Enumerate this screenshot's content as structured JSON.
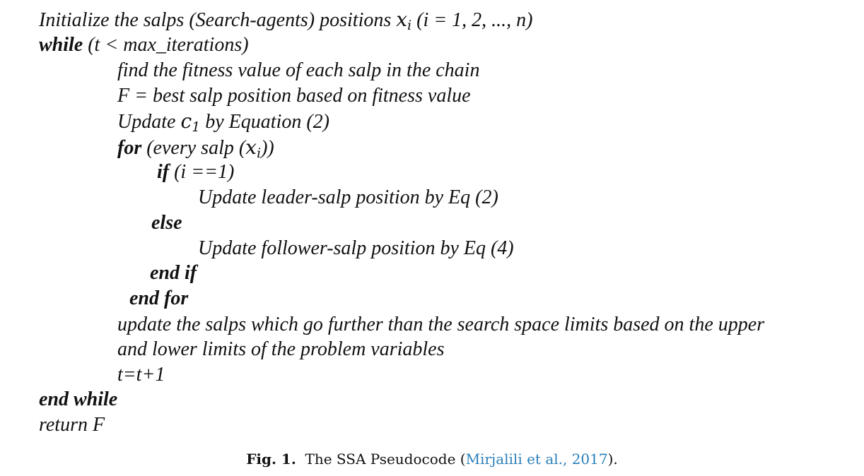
{
  "pseudocode": {
    "init": {
      "text_a": "Initialize the salps (Search-agents) positions ",
      "var_x": "x",
      "var_sub_i": "i",
      "text_b": " (i = 1, 2, ..., n)"
    },
    "while_line": {
      "keyword": "while",
      "condition": " (t < max_iterations)"
    },
    "fitness_line": "find the fitness value of each salp in the chain",
    "best_line": "F = best salp position based on fitness value",
    "update_c1": {
      "text_a": "Update ",
      "var_c": "c",
      "var_sub_1": "1",
      "text_b": " by Equation (2)"
    },
    "for_line": {
      "keyword": "for",
      "text_a": " (every salp (",
      "var_x": "x",
      "var_sub_i": "i",
      "text_b": "))"
    },
    "if_line": {
      "keyword": "if",
      "condition": " (i ==1)"
    },
    "leader_update": "Update leader-salp position by Eq (2)",
    "else_keyword": "else",
    "follower_update": "Update follower-salp position by Eq (4)",
    "end_if": "end if",
    "end_for": "end for",
    "limits_line_1": "update the salps which go further than the search space limits based on the upper",
    "limits_line_2": "and lower limits of the problem variables",
    "increment": "t=t+1",
    "end_while": "end while",
    "return_line": "return F"
  },
  "caption": {
    "label": "Fig. 1.",
    "text": "The SSA Pseudocode (",
    "citation": "Mirjalili et al., 2017",
    "closing": ")."
  },
  "colors": {
    "text": "#111111",
    "citation_link": "#2a7fb9",
    "background": "#ffffff"
  }
}
